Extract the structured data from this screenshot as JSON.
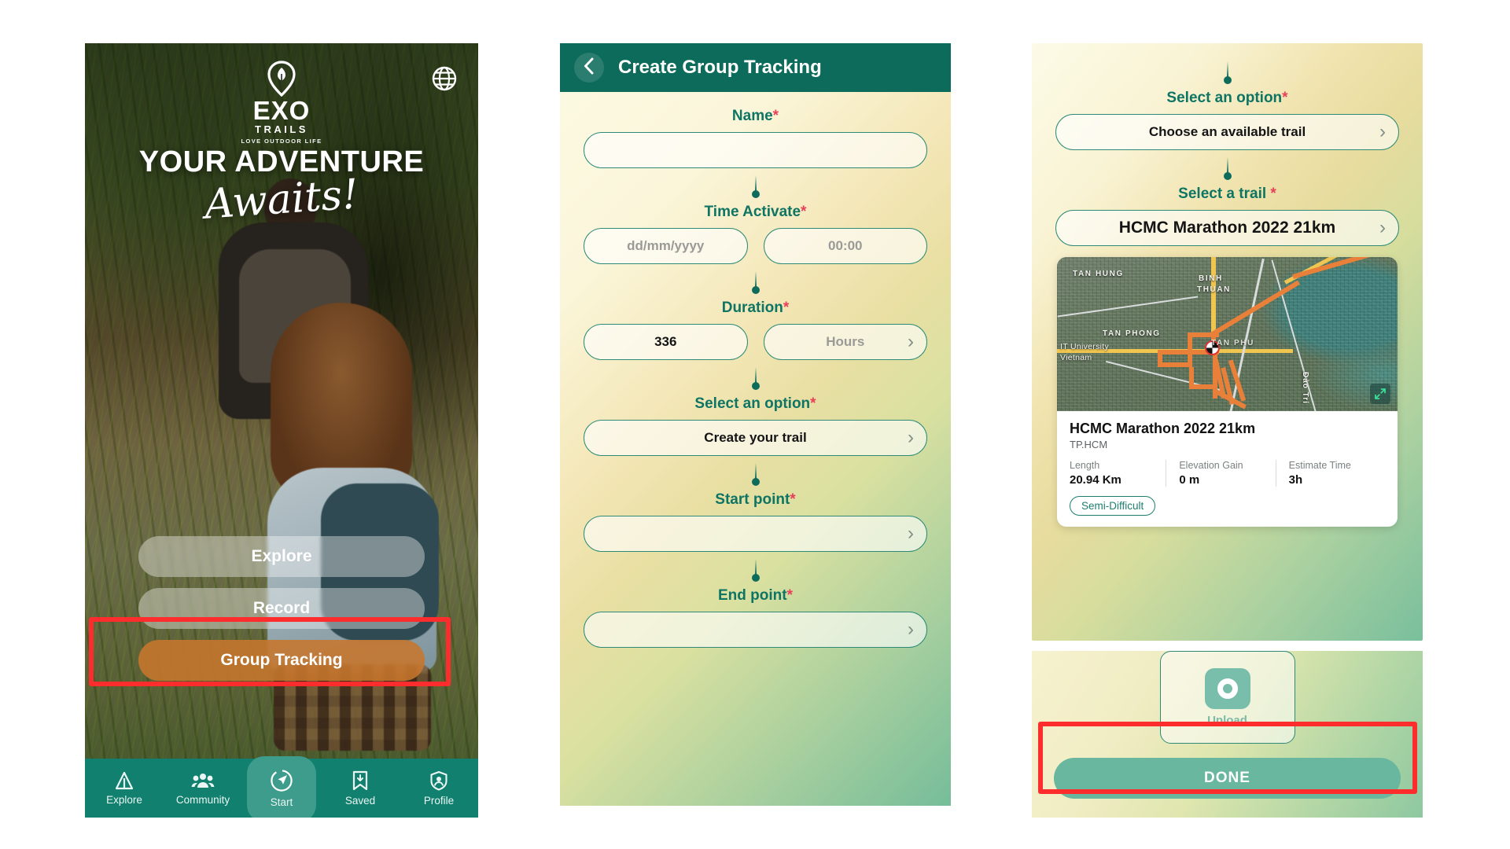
{
  "app": {
    "brand_primary": "#0d6b5c",
    "brand_accent": "#c7762c",
    "highlight_color": "#fd2d2d"
  },
  "panel_home": {
    "logo": {
      "mark_icon": "exo-pin-leaf-icon",
      "name": "EXO",
      "word": "TRAILS",
      "tagline": "LOVE OUTDOOR LIFE"
    },
    "language_icon": "globe-icon",
    "headline_line1": "YOUR ADVENTURE",
    "headline_line2": "Awaits!",
    "actions": [
      {
        "label": "Explore",
        "style": "ghost"
      },
      {
        "label": "Record",
        "style": "ghost"
      },
      {
        "label": "Group Tracking",
        "style": "accent"
      }
    ],
    "tabs": [
      {
        "label": "Explore",
        "icon": "tent-icon",
        "active": false
      },
      {
        "label": "Community",
        "icon": "people-group-icon",
        "active": false
      },
      {
        "label": "Start",
        "icon": "compass-navigate-icon",
        "active": true
      },
      {
        "label": "Saved",
        "icon": "bookmark-download-icon",
        "active": false
      },
      {
        "label": "Profile",
        "icon": "shield-user-icon",
        "active": false
      }
    ]
  },
  "panel_create": {
    "back_icon": "chevron-left-icon",
    "title": "Create Group Tracking",
    "fields": {
      "name": {
        "label": "Name",
        "required": "*",
        "value": "",
        "placeholder": ""
      },
      "time_activate": {
        "label": "Time Activate",
        "required": "*",
        "date_placeholder": "dd/mm/yyyy",
        "date_value": "",
        "time_placeholder": "00:00",
        "time_value": ""
      },
      "duration": {
        "label": "Duration",
        "required": "*",
        "amount_value": "336",
        "unit_placeholder": "Hours",
        "unit_value": ""
      },
      "select_option": {
        "label": "Select an option",
        "required": "*",
        "value": "Create your trail"
      },
      "start_point": {
        "label": "Start point",
        "required": "*",
        "value": ""
      },
      "end_point": {
        "label": "End point",
        "required": "*",
        "value": ""
      }
    }
  },
  "panel_trail": {
    "select_option": {
      "label": "Select an option",
      "required": "*",
      "value": "Choose an available trail"
    },
    "select_trail": {
      "label": "Select a trail ",
      "required": "*",
      "value": "HCMC Marathon 2022 21km"
    },
    "card": {
      "title": "HCMC Marathon 2022 21km",
      "subtitle": "TP.HCM",
      "stats": [
        {
          "key": "Length",
          "value": "20.94 Km"
        },
        {
          "key": "Elevation Gain",
          "value": "0 m"
        },
        {
          "key": "Estimate Time",
          "value": "3h"
        }
      ],
      "difficulty_badge": "Semi-Difficult",
      "expand_icon": "expand-arrows-icon",
      "map": {
        "type": "satellite",
        "route_color": "#e8803a",
        "start_marker_icon": "checkered-flag-icon",
        "labels": [
          "TAN HUNG",
          "BINH",
          "THUAN",
          "TAN PHONG",
          "IT University",
          "Vietnam",
          "TAN PHU",
          "Đảo Trí"
        ]
      }
    },
    "upload": {
      "icon": "camera-upload-icon",
      "label": "Upload"
    },
    "done_button": "DONE"
  }
}
